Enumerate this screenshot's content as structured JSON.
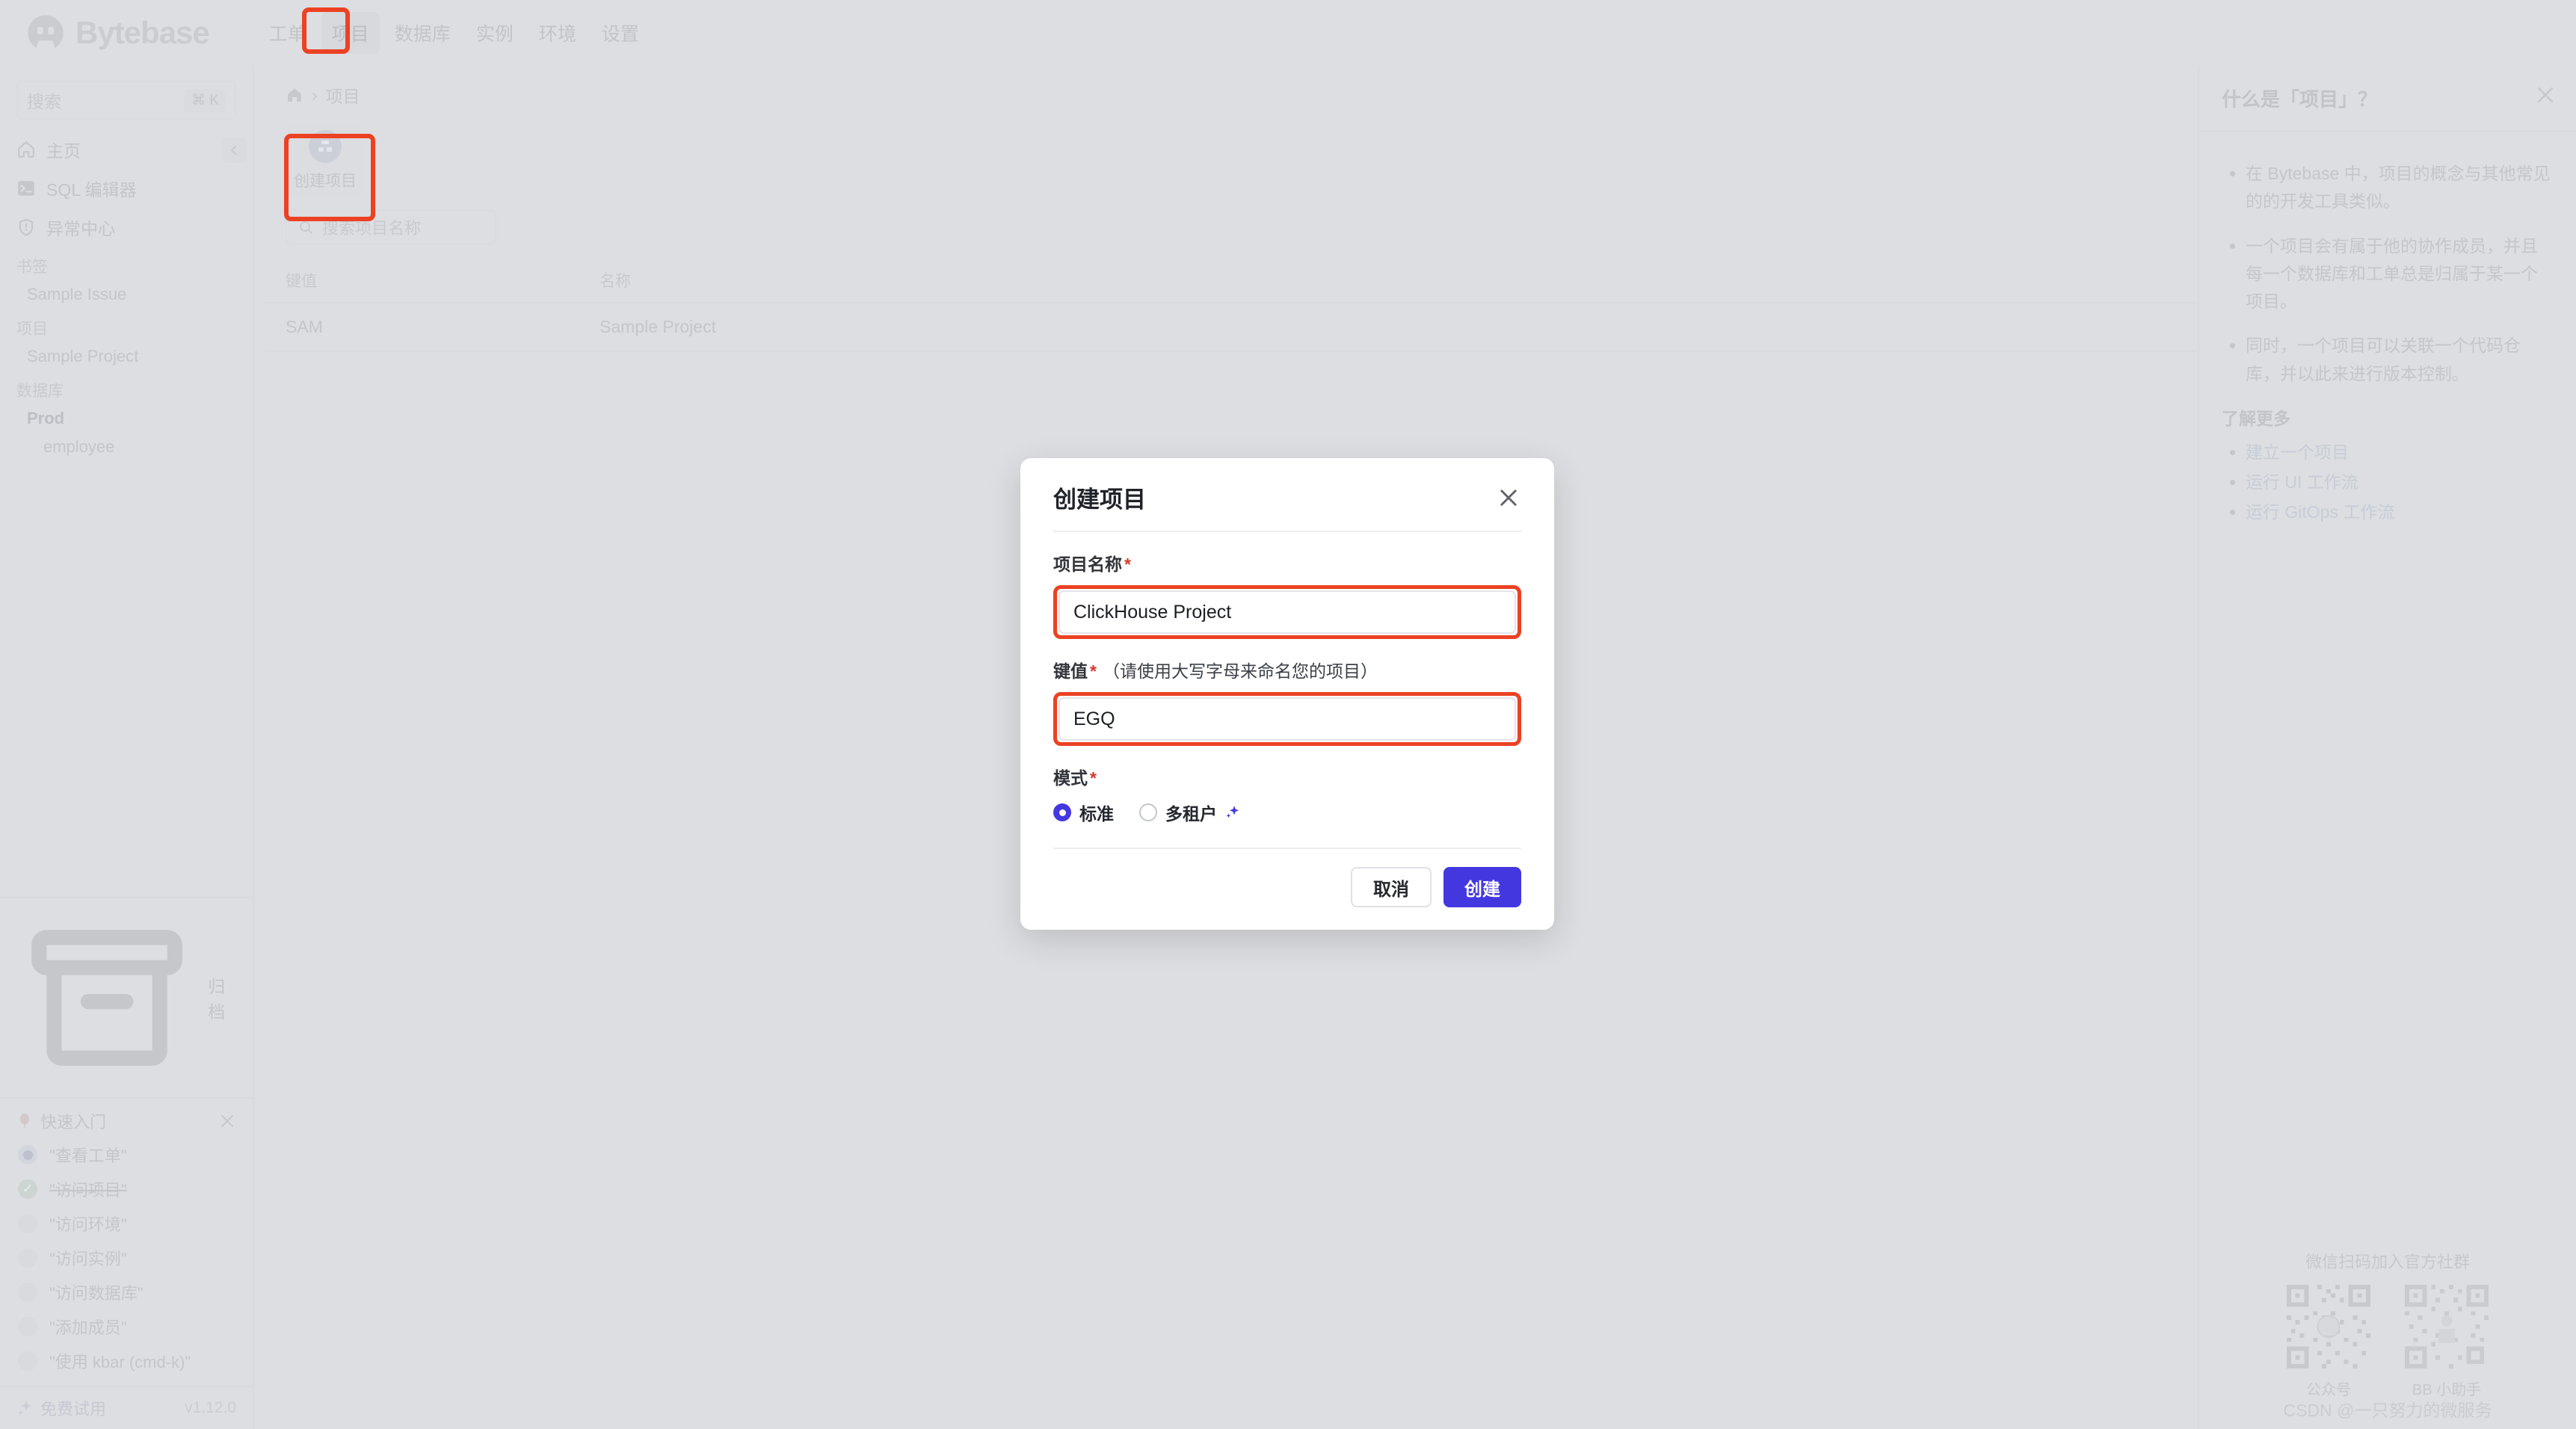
{
  "brand": {
    "name": "Bytebase",
    "logo_icon": "bytebase-logo-icon"
  },
  "topnav": {
    "items": [
      {
        "label": "工单",
        "active": false
      },
      {
        "label": "项目",
        "active": true
      },
      {
        "label": "数据库",
        "active": false
      },
      {
        "label": "实例",
        "active": false
      },
      {
        "label": "环境",
        "active": false
      },
      {
        "label": "设置",
        "active": false
      }
    ]
  },
  "sidebar": {
    "search": {
      "placeholder": "搜索",
      "shortcut": "⌘ K"
    },
    "nav": [
      {
        "label": "主页",
        "icon": "home-icon"
      },
      {
        "label": "SQL 编辑器",
        "icon": "terminal-icon"
      },
      {
        "label": "异常中心",
        "icon": "shield-alert-icon"
      }
    ],
    "sections": [
      {
        "label": "书签",
        "items": [
          {
            "label": "Sample Issue",
            "bold": false
          }
        ]
      },
      {
        "label": "项目",
        "items": [
          {
            "label": "Sample Project",
            "bold": false
          }
        ]
      },
      {
        "label": "数据库",
        "items": [
          {
            "label": "Prod",
            "bold": true
          },
          {
            "label": "employee",
            "bold": false,
            "indent": true
          }
        ]
      }
    ],
    "archive": {
      "label": "归档",
      "icon": "archive-icon"
    },
    "quickstart": {
      "title": "快速入门",
      "title_icon": "balloon-icon",
      "close_icon": "close-icon",
      "items": [
        {
          "label": "\"查看工单\"",
          "state": "current"
        },
        {
          "label": "\"访问项目\"",
          "state": "done"
        },
        {
          "label": "\"访问环境\"",
          "state": "todo"
        },
        {
          "label": "\"访问实例\"",
          "state": "todo"
        },
        {
          "label": "\"访问数据库\"",
          "state": "todo"
        },
        {
          "label": "\"添加成员\"",
          "state": "todo"
        },
        {
          "label": "\"使用 kbar (cmd-k)\"",
          "state": "todo"
        }
      ]
    },
    "footer": {
      "trial_label": "免费试用",
      "trial_icon": "sparkle-icon",
      "version": "v1.12.0"
    },
    "collapse_icon": "chevron-left-icon"
  },
  "main": {
    "breadcrumb": {
      "home_icon": "home-icon",
      "separator": "›",
      "current": "项目"
    },
    "create_card": {
      "label": "创建项目",
      "icon": "project-grid-icon"
    },
    "project_search": {
      "placeholder": "搜索项目名称",
      "icon": "search-icon"
    },
    "table": {
      "columns": [
        "键值",
        "名称"
      ],
      "rows": [
        {
          "key": "SAM",
          "name": "Sample Project"
        }
      ]
    }
  },
  "help_panel": {
    "title": "什么是「项目」？",
    "close_icon": "close-icon",
    "bullets": [
      "在 Bytebase 中，项目的概念与其他常见的的开发工具类似。",
      "一个项目会有属于他的协作成员，并且每一个数据库和工单总是归属于某一个项目。",
      "同时，一个项目可以关联一个代码仓库，并以此来进行版本控制。"
    ],
    "learn_more_label": "了解更多",
    "links": [
      "建立一个项目",
      "运行 UI 工作流",
      "运行 GitOps 工作流"
    ],
    "qr": {
      "title": "微信扫码加入官方社群",
      "codes": [
        {
          "caption": "公众号"
        },
        {
          "caption": "BB 小助手"
        }
      ]
    },
    "watermark": "CSDN @一只努力的微服务"
  },
  "modal": {
    "title": "创建项目",
    "close_icon": "close-icon",
    "name_field": {
      "label": "项目名称",
      "required_mark": "*",
      "value": "ClickHouse Project"
    },
    "key_field": {
      "label": "键值",
      "required_mark": "*",
      "hint": "（请使用大写字母来命名您的项目）",
      "value": "EGQ"
    },
    "mode_field": {
      "label": "模式",
      "required_mark": "*",
      "options": [
        {
          "label": "标准",
          "selected": true
        },
        {
          "label": "多租户",
          "selected": false,
          "badge_icon": "sparkle-icon"
        }
      ]
    },
    "cancel_label": "取消",
    "create_label": "创建"
  },
  "colors": {
    "accent": "#4338e0",
    "highlight": "#ec4123",
    "required": "#d23b2c",
    "link": "#9fb3e0",
    "page_bg": "#dcdee2"
  }
}
